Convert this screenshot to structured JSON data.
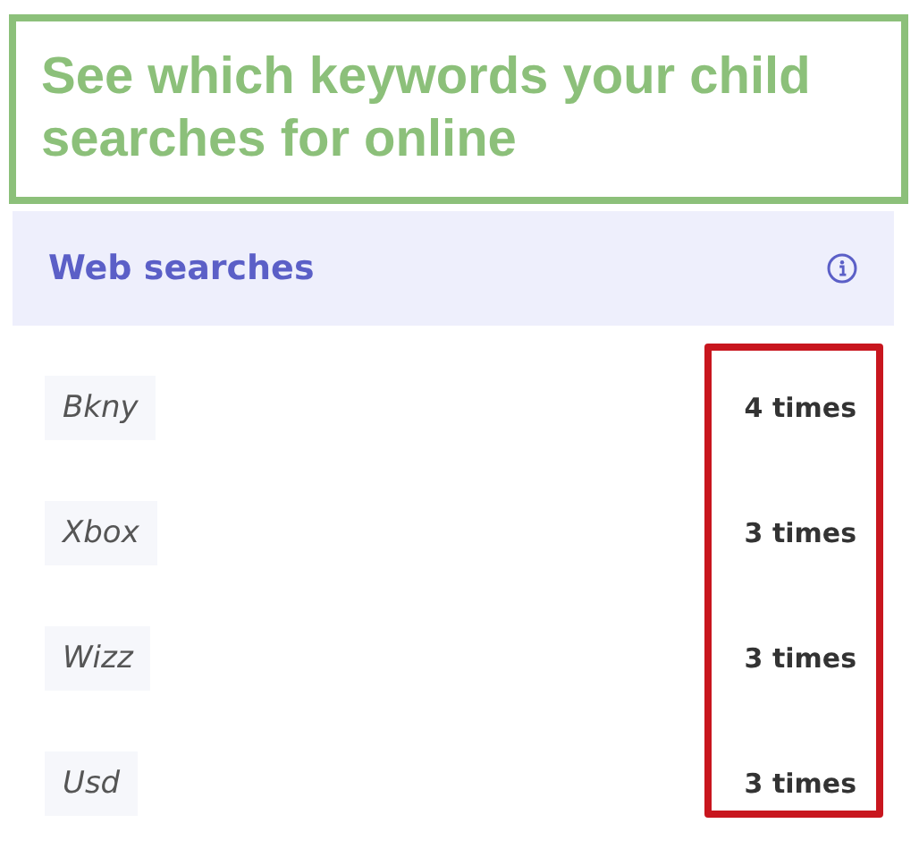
{
  "callout": {
    "text": "See which keywords your child searches for online"
  },
  "panel": {
    "title": "Web searches"
  },
  "searches": [
    {
      "keyword": "Bkny",
      "count": "4 times"
    },
    {
      "keyword": "Xbox",
      "count": "3 times"
    },
    {
      "keyword": "Wizz",
      "count": "3 times"
    },
    {
      "keyword": "Usd",
      "count": "3 times"
    }
  ],
  "highlight": {
    "shown": true
  }
}
